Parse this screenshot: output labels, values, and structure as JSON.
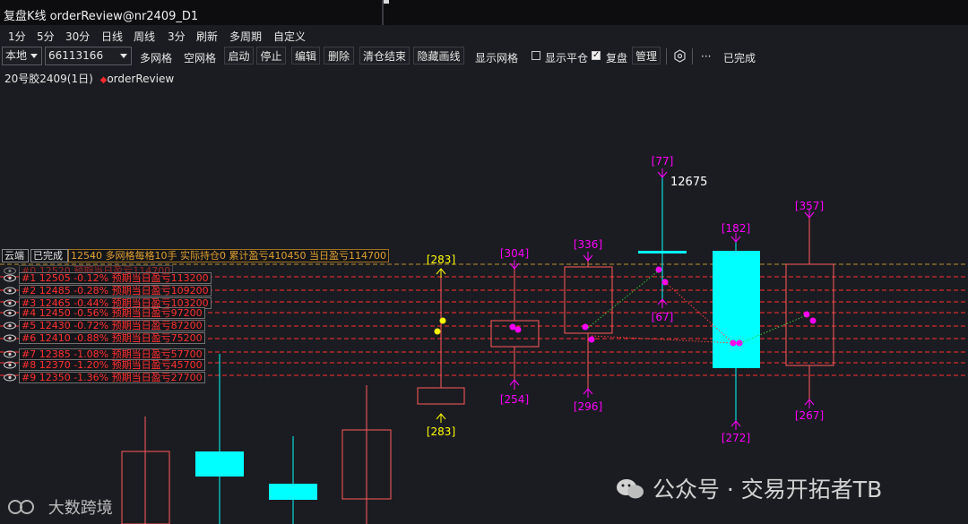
{
  "window": {
    "title": "复盘K线 orderReview@nr2409_D1"
  },
  "menu": [
    "1分",
    "5分",
    "30分",
    "日线",
    "周线",
    "3分",
    "刷新",
    "多周期",
    "自定义"
  ],
  "toolbar": {
    "source_select": "本地",
    "account_select": "66113166",
    "buttons": [
      "多网格",
      "空网格",
      "启动",
      "停止",
      "编辑",
      "删除",
      "清仓结束",
      "隐藏画线"
    ],
    "show_grid_label": "显示网格",
    "show_flat_label": "显示平仓",
    "show_flat_checked": false,
    "replay_label": "复盘",
    "replay_checked": true,
    "manage_button": "管理",
    "more_label": "···",
    "status": "已完成"
  },
  "symbol": {
    "name": "20号胶2409(1日)",
    "strategy": "orderReview"
  },
  "grid_panel": {
    "tag_yun": "云端",
    "tag_done": "已完成",
    "summary": "12540 多网格每格10手 实际持仓0 累计盈亏410450 当日盈亏114700",
    "rows": [
      {
        "label": "#0 12520 预期当日盈亏114700"
      },
      {
        "label": "#1 12505 -0.12% 预期当日盈亏113200"
      },
      {
        "label": "#2 12485 -0.28% 预期当日盈亏109200"
      },
      {
        "label": "#3 12465 -0.44% 预期当日盈亏103200"
      },
      {
        "label": "#4 12450 -0.56% 预期当日盈亏97200"
      },
      {
        "label": "#5 12430 -0.72% 预期当日盈亏87200"
      },
      {
        "label": "#6 12410 -0.88% 预期当日盈亏75200"
      },
      {
        "label": "#7 12385 -1.08% 预期当日盈亏57700"
      },
      {
        "label": "#8 12370 -1.20% 预期当日盈亏45700"
      },
      {
        "label": "#9 12350 -1.36% 预期当日盈亏27700"
      }
    ]
  },
  "candles_labels": {
    "c1_top": "[283]",
    "c1_bot": "[283]",
    "c2_top": "[304]",
    "c2_bot": "[254]",
    "c3_top": "[336]",
    "c3_bot": "[296]",
    "c4_top": "[77]",
    "c4_bot": "[67]",
    "c4_high": "12675",
    "c5_top": "[182]",
    "c5_bot": "[272]",
    "c6_top": "[357]",
    "c6_bot": "[267]"
  },
  "colors": {
    "up": "#ff5a5a",
    "down": "#00ffff",
    "grid_line": "#ff3030",
    "marker": "#ff00ff",
    "marker_first": "#ffff00"
  },
  "watermarks": {
    "left": "大数跨境",
    "right": "公众号 · 交易开拓者TB"
  }
}
